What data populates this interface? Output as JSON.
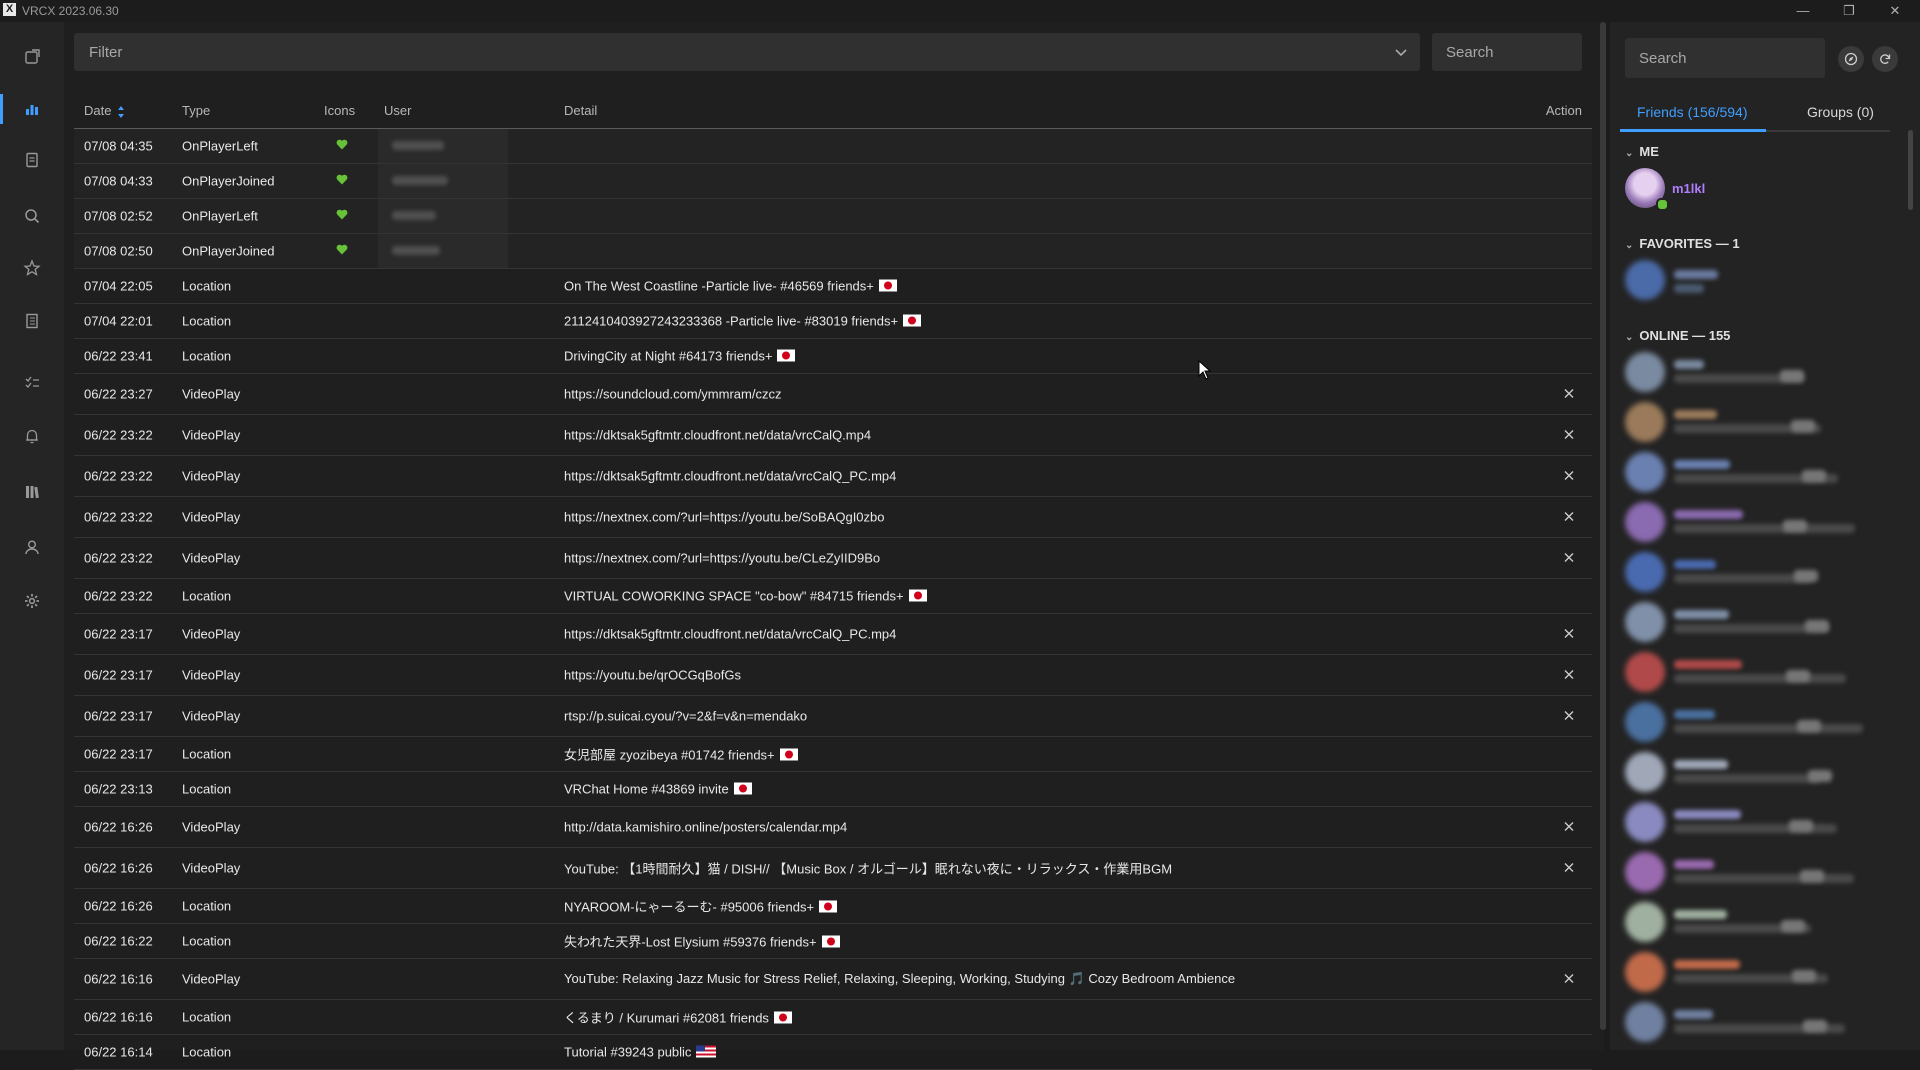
{
  "window": {
    "title": "VRCX 2023.06.30",
    "logo": "X",
    "controls": [
      "minimize",
      "restore",
      "close"
    ]
  },
  "nav": {
    "items": [
      {
        "name": "nav-feed",
        "icon": "feed-icon",
        "active": false
      },
      {
        "name": "nav-gamelog",
        "icon": "bar-chart-icon",
        "active": true
      },
      {
        "name": "nav-playerlist",
        "icon": "document-icon",
        "active": false
      },
      {
        "name": "nav-search",
        "icon": "search-icon",
        "active": false
      },
      {
        "name": "nav-favorites",
        "icon": "star-icon",
        "active": false
      },
      {
        "name": "nav-social",
        "icon": "notebook-icon",
        "active": false
      },
      {
        "name": "nav-moderation",
        "icon": "checklist-icon",
        "active": false
      },
      {
        "name": "nav-notifications",
        "icon": "bell-icon",
        "active": false
      },
      {
        "name": "nav-library",
        "icon": "books-icon",
        "active": false
      },
      {
        "name": "nav-profile",
        "icon": "user-icon",
        "active": false
      },
      {
        "name": "nav-settings",
        "icon": "gear-icon",
        "active": false
      }
    ]
  },
  "toolbar": {
    "filter_placeholder": "Filter",
    "search_placeholder": "Search"
  },
  "table": {
    "headers": {
      "date": "Date",
      "type": "Type",
      "icons": "Icons",
      "user": "User",
      "detail": "Detail",
      "action": "Action"
    },
    "rows": [
      {
        "date": "07/08 04:35",
        "type": "OnPlayerLeft",
        "icon": "heart",
        "user_hidden": true,
        "detail": "",
        "flag": "",
        "action": false,
        "h": 34
      },
      {
        "date": "07/08 04:33",
        "type": "OnPlayerJoined",
        "icon": "heart",
        "user_hidden": true,
        "detail": "",
        "flag": "",
        "action": false,
        "h": 34
      },
      {
        "date": "07/08 02:52",
        "type": "OnPlayerLeft",
        "icon": "heart",
        "user_hidden": true,
        "detail": "",
        "flag": "",
        "action": false,
        "h": 34
      },
      {
        "date": "07/08 02:50",
        "type": "OnPlayerJoined",
        "icon": "heart",
        "user_hidden": true,
        "detail": "",
        "flag": "",
        "action": false,
        "h": 34
      },
      {
        "date": "07/04 22:05",
        "type": "Location",
        "icon": "",
        "user_hidden": false,
        "detail": "On The West Coastline -Particle live- #46569 friends+",
        "flag": "jp",
        "action": false,
        "h": 34
      },
      {
        "date": "07/04 22:01",
        "type": "Location",
        "icon": "",
        "user_hidden": false,
        "detail": "2112410403927243233368 -Particle live- #83019 friends+",
        "flag": "jp",
        "action": false,
        "h": 34
      },
      {
        "date": "06/22 23:41",
        "type": "Location",
        "icon": "",
        "user_hidden": false,
        "detail": "DrivingCity at Night #64173 friends+",
        "flag": "jp",
        "action": false,
        "h": 34
      },
      {
        "date": "06/22 23:27",
        "type": "VideoPlay",
        "icon": "",
        "user_hidden": false,
        "detail": "https://soundcloud.com/ymmram/czcz",
        "flag": "",
        "action": true,
        "h": 40
      },
      {
        "date": "06/22 23:22",
        "type": "VideoPlay",
        "icon": "",
        "user_hidden": false,
        "detail": "https://dktsak5gftmtr.cloudfront.net/data/vrcCalQ.mp4",
        "flag": "",
        "action": true,
        "h": 40
      },
      {
        "date": "06/22 23:22",
        "type": "VideoPlay",
        "icon": "",
        "user_hidden": false,
        "detail": "https://dktsak5gftmtr.cloudfront.net/data/vrcCalQ_PC.mp4",
        "flag": "",
        "action": true,
        "h": 40
      },
      {
        "date": "06/22 23:22",
        "type": "VideoPlay",
        "icon": "",
        "user_hidden": false,
        "detail": "https://nextnex.com/?url=https://youtu.be/SoBAQgI0zbo",
        "flag": "",
        "action": true,
        "h": 40
      },
      {
        "date": "06/22 23:22",
        "type": "VideoPlay",
        "icon": "",
        "user_hidden": false,
        "detail": "https://nextnex.com/?url=https://youtu.be/CLeZyIID9Bo",
        "flag": "",
        "action": true,
        "h": 40
      },
      {
        "date": "06/22 23:22",
        "type": "Location",
        "icon": "",
        "user_hidden": false,
        "detail": "VIRTUAL COWORKING SPACE \"co-bow\" #84715 friends+",
        "flag": "jp",
        "action": false,
        "h": 34
      },
      {
        "date": "06/22 23:17",
        "type": "VideoPlay",
        "icon": "",
        "user_hidden": false,
        "detail": "https://dktsak5gftmtr.cloudfront.net/data/vrcCalQ_PC.mp4",
        "flag": "",
        "action": true,
        "h": 40
      },
      {
        "date": "06/22 23:17",
        "type": "VideoPlay",
        "icon": "",
        "user_hidden": false,
        "detail": "https://youtu.be/qrOCGqBofGs",
        "flag": "",
        "action": true,
        "h": 40
      },
      {
        "date": "06/22 23:17",
        "type": "VideoPlay",
        "icon": "",
        "user_hidden": false,
        "detail": "rtsp://p.suicai.cyou/?v=2&f=v&n=mendako",
        "flag": "",
        "action": true,
        "h": 40
      },
      {
        "date": "06/22 23:17",
        "type": "Location",
        "icon": "",
        "user_hidden": false,
        "detail": "女児部屋 zyozibeya #01742 friends+",
        "flag": "jp",
        "action": false,
        "h": 34
      },
      {
        "date": "06/22 23:13",
        "type": "Location",
        "icon": "",
        "user_hidden": false,
        "detail": "VRChat Home #43869 invite",
        "flag": "jp",
        "action": false,
        "h": 34
      },
      {
        "date": "06/22 16:26",
        "type": "VideoPlay",
        "icon": "",
        "user_hidden": false,
        "detail": "http://data.kamishiro.online/posters/calendar.mp4",
        "flag": "",
        "action": true,
        "h": 40
      },
      {
        "date": "06/22 16:26",
        "type": "VideoPlay",
        "icon": "",
        "user_hidden": false,
        "detail": "YouTube: 【1時間耐久】猫 / DISH// 【Music Box / オルゴール】眠れない夜に・リラックス・作業用BGM",
        "flag": "",
        "action": true,
        "h": 40
      },
      {
        "date": "06/22 16:26",
        "type": "Location",
        "icon": "",
        "user_hidden": false,
        "detail": "NYAROOM-にゃーるーむ- #95006 friends+",
        "flag": "jp",
        "action": false,
        "h": 34
      },
      {
        "date": "06/22 16:22",
        "type": "Location",
        "icon": "",
        "user_hidden": false,
        "detail": "失われた天界-Lost Elysium #59376 friends+",
        "flag": "jp",
        "action": false,
        "h": 34
      },
      {
        "date": "06/22 16:16",
        "type": "VideoPlay",
        "icon": "",
        "user_hidden": false,
        "detail": "YouTube: Relaxing Jazz Music for Stress Relief, Relaxing, Sleeping, Working, Studying 🎵 Cozy Bedroom Ambience",
        "flag": "",
        "action": true,
        "h": 40
      },
      {
        "date": "06/22 16:16",
        "type": "Location",
        "icon": "",
        "user_hidden": false,
        "detail": "くるまり / Kurumari #62081 friends",
        "flag": "jp",
        "action": false,
        "h": 34
      },
      {
        "date": "06/22 16:14",
        "type": "Location",
        "icon": "",
        "user_hidden": false,
        "detail": "Tutorial #39243 public",
        "flag": "us",
        "action": false,
        "h": 34
      }
    ]
  },
  "sidebar": {
    "search_placeholder": "Search",
    "tabs": {
      "friends": "Friends (156/594)",
      "groups": "Groups (0)"
    },
    "groups": {
      "me": "ME",
      "favorites": "FAVORITES — 1",
      "online": "ONLINE — 155"
    },
    "me_name": "m1lkl",
    "online_avatar_colors": [
      "#7a8aa0",
      "#9a7a5a",
      "#6a80b0",
      "#8a6ab0",
      "#4a6ab0",
      "#8090a8",
      "#b04a4a",
      "#4a70a0",
      "#a0a8b8",
      "#8a8ac0",
      "#9a6ab0",
      "#a0b0a0",
      "#c06a4a",
      "#7080a0"
    ]
  },
  "colors": {
    "accent": "#409eff",
    "me_name": "#b07dff",
    "online": "#67c23a",
    "heart": "#67c23a"
  }
}
